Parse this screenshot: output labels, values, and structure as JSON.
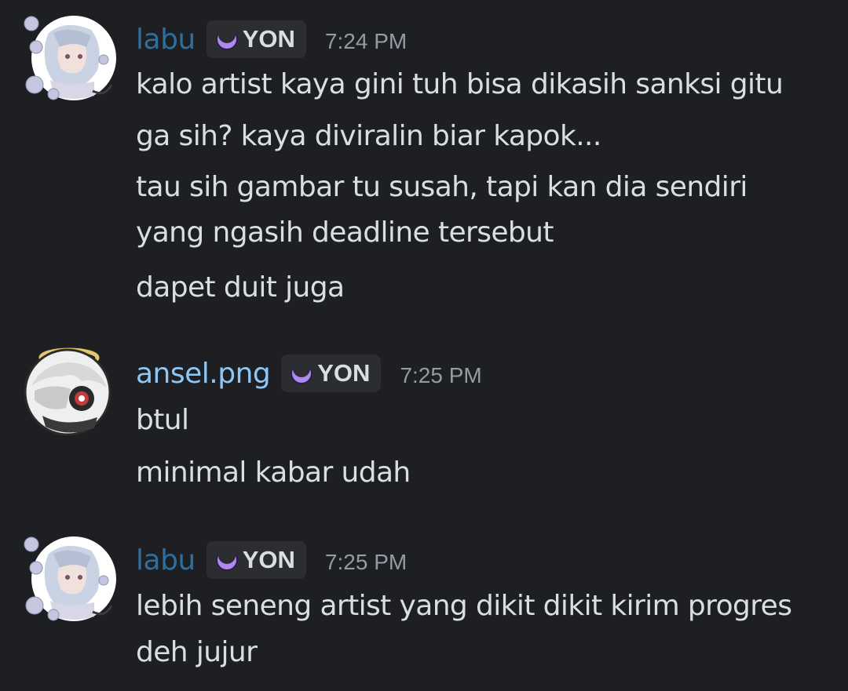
{
  "colors": {
    "background": "#1e1f22",
    "labu_name": "#2e6f9e",
    "ansel_name": "#8ec7f5",
    "tag_bg": "#2b2d31",
    "tag_icon": "#b089f0",
    "timestamp": "#949ba4",
    "message_text": "#dbdee1"
  },
  "messages": [
    {
      "username": "labu",
      "tag": "YON",
      "tag_icon": "crescent-moon-icon",
      "timestamp": "7:24 PM",
      "lines": [
        "kalo artist kaya gini tuh bisa dikasih sanksi gitu",
        "ga sih? kaya diviralin biar kapok...",
        "tau sih gambar tu susah, tapi kan dia sendiri",
        "yang ngasih deadline tersebut",
        "dapet duit juga"
      ]
    },
    {
      "username": "ansel.png",
      "tag": "YON",
      "tag_icon": "crescent-moon-icon",
      "timestamp": "7:25 PM",
      "lines": [
        "btul",
        "minimal kabar udah"
      ]
    },
    {
      "username": "labu",
      "tag": "YON",
      "tag_icon": "crescent-moon-icon",
      "timestamp": "7:25 PM",
      "lines": [
        "lebih seneng artist yang dikit dikit kirim progres",
        "deh jujur"
      ]
    }
  ]
}
